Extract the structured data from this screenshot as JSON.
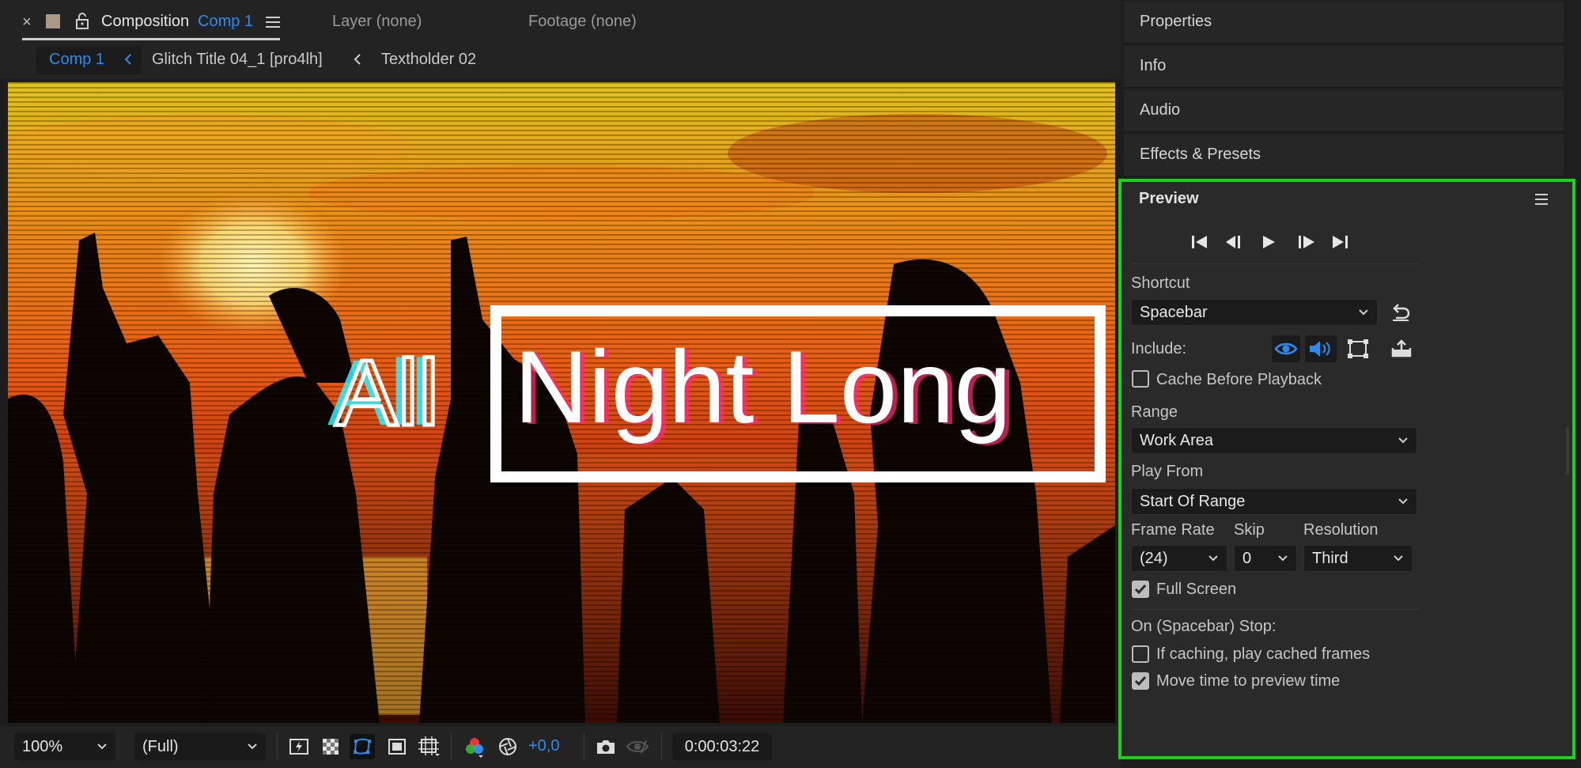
{
  "composition": {
    "tabs": {
      "close_symbol": "×",
      "composition_label": "Composition",
      "composition_name": "Comp 1",
      "layer": "Layer (none)",
      "footage": "Footage (none)"
    },
    "breadcrumbs": [
      "Comp 1",
      "Glitch Title 04_1 [pro4lh]",
      "Textholder 02"
    ],
    "viewer_text": {
      "word1": "All",
      "word2": "Night Long"
    },
    "bottom_bar": {
      "zoom": "100%",
      "resolution": "(Full)",
      "exposure": "+0,0",
      "timecode": "0:00:03:22"
    },
    "accent_color": "#2d8ceb"
  },
  "panels": {
    "properties": "Properties",
    "info": "Info",
    "audio": "Audio",
    "effects_presets": "Effects & Presets"
  },
  "preview": {
    "title": "Preview",
    "shortcut_label": "Shortcut",
    "shortcut_value": "Spacebar",
    "include_label": "Include:",
    "cache_before_playback": "Cache Before Playback",
    "range_label": "Range",
    "range_value": "Work Area",
    "play_from_label": "Play From",
    "play_from_value": "Start Of Range",
    "frame_rate_label": "Frame Rate",
    "frame_rate_value": "(24)",
    "skip_label": "Skip",
    "skip_value": "0",
    "resolution_label": "Resolution",
    "resolution_value": "Third",
    "full_screen": "Full Screen",
    "on_stop_label": "On (Spacebar) Stop:",
    "if_caching": "If caching, play cached frames",
    "move_time": "Move time to preview time",
    "checkboxes": {
      "cache_before_playback": false,
      "full_screen": true,
      "if_caching": false,
      "move_time": true
    },
    "highlight_color": "#1bd31b"
  }
}
